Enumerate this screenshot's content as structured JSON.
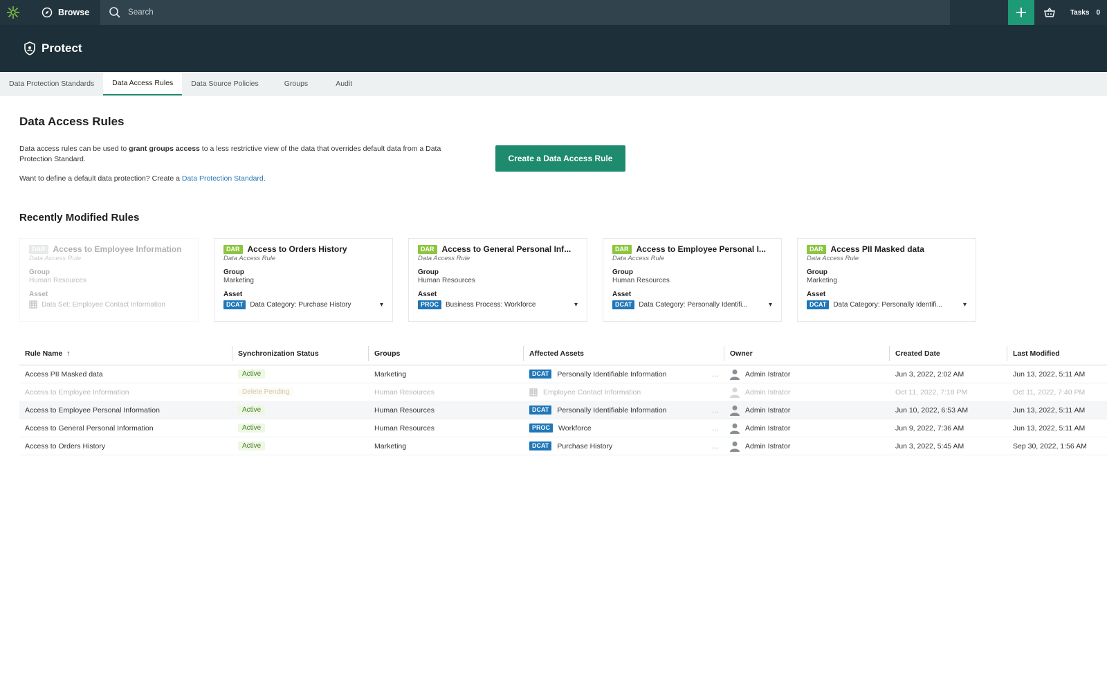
{
  "topbar": {
    "browse_label": "Browse",
    "search_placeholder": "Search",
    "tasks_label": "Tasks",
    "tasks_count": "0"
  },
  "app": {
    "title": "Protect"
  },
  "tabs": [
    {
      "label": "Data Protection Standards"
    },
    {
      "label": "Data Access Rules"
    },
    {
      "label": "Data Source Policies"
    },
    {
      "label": "Groups"
    },
    {
      "label": "Audit"
    }
  ],
  "page": {
    "title": "Data Access Rules",
    "desc_part1": "Data access rules can be used to ",
    "desc_bold": "grant groups access",
    "desc_part2": " to a less restrictive view of the data that overrides default data from a Data Protection Standard.",
    "define_prefix": "Want to define a default data protection? Create a ",
    "define_link": "Data Protection Standard",
    "define_suffix": ".",
    "create_button": "Create a Data Access Rule",
    "recent_title": "Recently Modified Rules"
  },
  "cards": [
    {
      "badge": "DAR",
      "name": "Access to Employee Information",
      "kind": "Data Access Rule",
      "group_label": "Group",
      "group": "Human Resources",
      "asset_label": "Asset",
      "asset_badge": "",
      "asset": "Data Set: Employee Contact Information"
    },
    {
      "badge": "DAR",
      "name": "Access to Orders History",
      "kind": "Data Access Rule",
      "group_label": "Group",
      "group": "Marketing",
      "asset_label": "Asset",
      "asset_badge": "DCAT",
      "asset": "Data Category: Purchase History"
    },
    {
      "badge": "DAR",
      "name": "Access to General Personal Inf...",
      "kind": "Data Access Rule",
      "group_label": "Group",
      "group": "Human Resources",
      "asset_label": "Asset",
      "asset_badge": "PROC",
      "asset": "Business Process: Workforce"
    },
    {
      "badge": "DAR",
      "name": "Access to Employee Personal I...",
      "kind": "Data Access Rule",
      "group_label": "Group",
      "group": "Human Resources",
      "asset_label": "Asset",
      "asset_badge": "DCAT",
      "asset": "Data Category: Personally Identifi..."
    },
    {
      "badge": "DAR",
      "name": "Access PII Masked data",
      "kind": "Data Access Rule",
      "group_label": "Group",
      "group": "Marketing",
      "asset_label": "Asset",
      "asset_badge": "DCAT",
      "asset": "Data Category: Personally Identifi..."
    }
  ],
  "table": {
    "headers": [
      "Rule Name",
      "Synchronization Status",
      "Groups",
      "Affected Assets",
      "Owner",
      "Created Date",
      "Last Modified"
    ],
    "sort_indicator": "↑",
    "rows": [
      {
        "name": "Access PII Masked data",
        "status": "Active",
        "group": "Marketing",
        "asset_badge": "DCAT",
        "asset": "Personally Identifiable Information",
        "owner": "Admin Istrator",
        "created": "Jun 3, 2022, 2:02 AM",
        "modified": "Jun 13, 2022, 5:11 AM"
      },
      {
        "name": "Access to Employee Information",
        "status": "Delete Pending",
        "group": "Human Resources",
        "asset_badge": "",
        "asset": "Employee Contact Information",
        "owner": "Admin Istrator",
        "created": "Oct 11, 2022, 7:18 PM",
        "modified": "Oct 11, 2022, 7:40 PM"
      },
      {
        "name": "Access to Employee Personal Information",
        "status": "Active",
        "group": "Human Resources",
        "asset_badge": "DCAT",
        "asset": "Personally Identifiable Information",
        "owner": "Admin Istrator",
        "created": "Jun 10, 2022, 6:53 AM",
        "modified": "Jun 13, 2022, 5:11 AM"
      },
      {
        "name": "Access to General Personal Information",
        "status": "Active",
        "group": "Human Resources",
        "asset_badge": "PROC",
        "asset": "Workforce",
        "owner": "Admin Istrator",
        "created": "Jun 9, 2022, 7:36 AM",
        "modified": "Jun 13, 2022, 5:11 AM"
      },
      {
        "name": "Access to Orders History",
        "status": "Active",
        "group": "Marketing",
        "asset_badge": "DCAT",
        "asset": "Purchase History",
        "owner": "Admin Istrator",
        "created": "Jun 3, 2022, 5:45 AM",
        "modified": "Sep 30, 2022, 1:56 AM"
      }
    ]
  },
  "colors": {
    "primary": "#1e8a6e",
    "header_bg": "#1d2f38",
    "badge_dar": "#8cc63f",
    "badge_dcat": "#1f76b9"
  }
}
